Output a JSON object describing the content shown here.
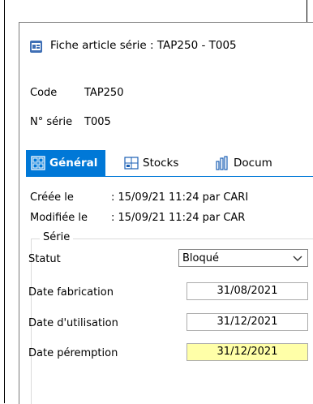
{
  "window": {
    "title": "Fiche article série : TAP250 - T005"
  },
  "header": {
    "code_label": "Code",
    "code_value": "TAP250",
    "serie_label": "N° série",
    "serie_value": "T005"
  },
  "tabs": [
    {
      "label": "Général",
      "icon": "general-icon",
      "active": true
    },
    {
      "label": "Stocks",
      "icon": "stocks-icon",
      "active": false
    },
    {
      "label": "Docum",
      "icon": "documents-icon",
      "active": false
    }
  ],
  "meta": {
    "created_label": "Créée le",
    "created_value": ": 15/09/21 11:24 par CARI",
    "modified_label": "Modifiée le",
    "modified_value": ": 15/09/21 11:24 par CAR"
  },
  "serie_group": {
    "legend": "Série",
    "statut_label": "Statut",
    "statut_value": "Bloqué",
    "fabrication_label": "Date fabrication",
    "fabrication_value": "31/08/2021",
    "utilisation_label": "Date d'utilisation",
    "utilisation_value": "31/12/2021",
    "peremption_label": "Date péremption",
    "peremption_value": "31/12/2021"
  },
  "colors": {
    "accent": "#0078d7",
    "highlight": "#ffffa8"
  }
}
